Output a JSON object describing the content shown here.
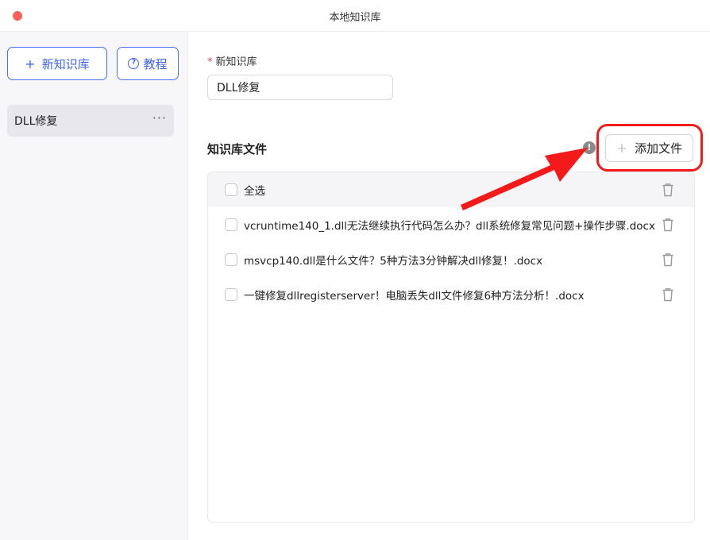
{
  "window": {
    "title": "本地知识库"
  },
  "sidebar": {
    "new_button": {
      "icon": "plus-icon",
      "label": "新知识库"
    },
    "tutorial_button": {
      "icon": "question-circle-icon",
      "label": "教程"
    },
    "items": [
      {
        "label": "DLL修复",
        "more": "···"
      }
    ]
  },
  "form": {
    "required_mark": "*",
    "name_label": "新知识库",
    "name_value": "DLL修复"
  },
  "files": {
    "section_title": "知识库文件",
    "info_icon": "!",
    "add_button": {
      "icon": "plus-icon",
      "label": "添加文件"
    },
    "select_all": "全选",
    "rows": [
      {
        "name": "vcruntime140_1.dll无法继续执行代码怎么办？dll系统修复常见问题+操作步骤.docx"
      },
      {
        "name": "msvcp140.dll是什么文件？5种方法3分钟解决dll修复！.docx"
      },
      {
        "name": "一键修复dllregisterserver！电脑丢失dll文件修复6种方法分析！.docx"
      }
    ]
  },
  "colors": {
    "accent": "#3d63ec",
    "annotation": "#f41a1a",
    "close": "#fe5f57"
  }
}
